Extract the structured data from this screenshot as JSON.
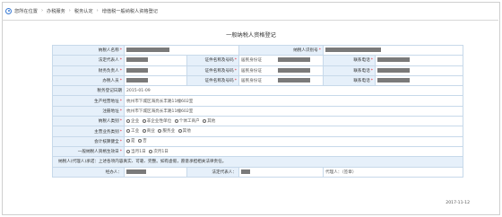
{
  "breadcrumb": {
    "prefix": "您所在位置",
    "items": [
      "办税服务",
      "税务认定",
      "增值税一般纳税人资格登记"
    ]
  },
  "form": {
    "title": "一般纳税人资格登记",
    "taxpayer_name_label": "纳税人名称",
    "taxpayer_id_label": "纳税人识别号",
    "legal_rep_label": "法定代表人",
    "finance_head_label": "财务负责人",
    "handler_label": "办税人员",
    "id_type_label": "证件名称及号码",
    "id_type_value": "居民身份证",
    "phone_label": "联系电话",
    "reg_date_label": "税务登记日期",
    "reg_date_value": "2015-01-09",
    "biz_addr_label": "生产经营地址",
    "biz_addr_value": "杭州市下城区海亮长丰路11幢602室",
    "reg_addr_label": "注册地址",
    "reg_addr_value": "杭州市下城区海亮长丰路11幢602室",
    "category_label": "纳税人类别",
    "category_options": [
      "企业",
      "非企业性单位",
      "个体工商户",
      "其他"
    ],
    "business_label": "主营业务类别",
    "business_options": [
      "工业",
      "商业",
      "服务业",
      "其他"
    ],
    "accounting_label": "会计核算健全",
    "accounting_options": [
      "是",
      "否"
    ],
    "effective_label": "一般纳税人资格生效日",
    "effective_options": [
      "当月1日",
      "次月1日"
    ],
    "declaration": "纳税人(代理人)承诺：上述各项内容真实、可靠、完整。如有虚假，愿意承担相关法律责任。",
    "agent_label": "经办人：",
    "legal_sign_label": "法定代表人：",
    "proxy_label": "代理人：（签章）",
    "date": "2017-11-12"
  },
  "colors": {
    "label_bg": "#e6f0fa",
    "border": "#c7d9ea",
    "required": "#e22233",
    "mask": "#7a7a7a"
  }
}
